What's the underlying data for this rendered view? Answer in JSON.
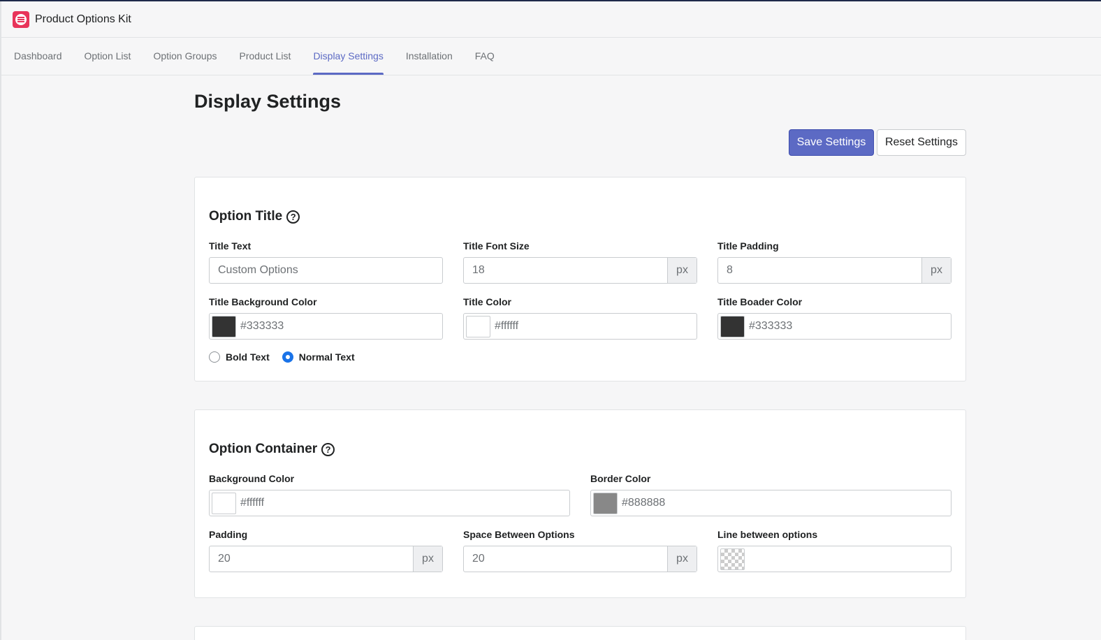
{
  "app": {
    "title": "Product Options Kit"
  },
  "tabs": [
    {
      "label": "Dashboard"
    },
    {
      "label": "Option List"
    },
    {
      "label": "Option Groups"
    },
    {
      "label": "Product List"
    },
    {
      "label": "Display Settings",
      "active": true
    },
    {
      "label": "Installation"
    },
    {
      "label": "FAQ"
    }
  ],
  "page": {
    "title": "Display Settings",
    "save_label": "Save Settings",
    "reset_label": "Reset Settings"
  },
  "option_title": {
    "heading": "Option Title",
    "title_text": {
      "label": "Title Text",
      "value": "Custom Options"
    },
    "font_size": {
      "label": "Title Font Size",
      "value": "18",
      "unit": "px"
    },
    "padding": {
      "label": "Title Padding",
      "value": "8",
      "unit": "px"
    },
    "bg_color": {
      "label": "Title Background Color",
      "value": "#333333",
      "color": "#333333"
    },
    "color": {
      "label": "Title Color",
      "value": "#ffffff",
      "color": "#ffffff"
    },
    "border_color": {
      "label": "Title Boader Color",
      "value": "#333333",
      "color": "#333333"
    },
    "style_options": [
      {
        "label": "Bold Text",
        "checked": false
      },
      {
        "label": "Normal Text",
        "checked": true
      }
    ]
  },
  "option_container": {
    "heading": "Option Container",
    "bg_color": {
      "label": "Background Color",
      "value": "#ffffff",
      "color": "#ffffff"
    },
    "border_color": {
      "label": "Border Color",
      "value": "#888888",
      "color": "#888888"
    },
    "padding": {
      "label": "Padding",
      "value": "20",
      "unit": "px"
    },
    "space_between": {
      "label": "Space Between Options",
      "value": "20",
      "unit": "px"
    },
    "line_between": {
      "label": "Line between options",
      "value": ""
    }
  },
  "colors": {
    "accent": "#5c6ac4",
    "radio": "#1a73e8",
    "logo": "#e8345a"
  }
}
